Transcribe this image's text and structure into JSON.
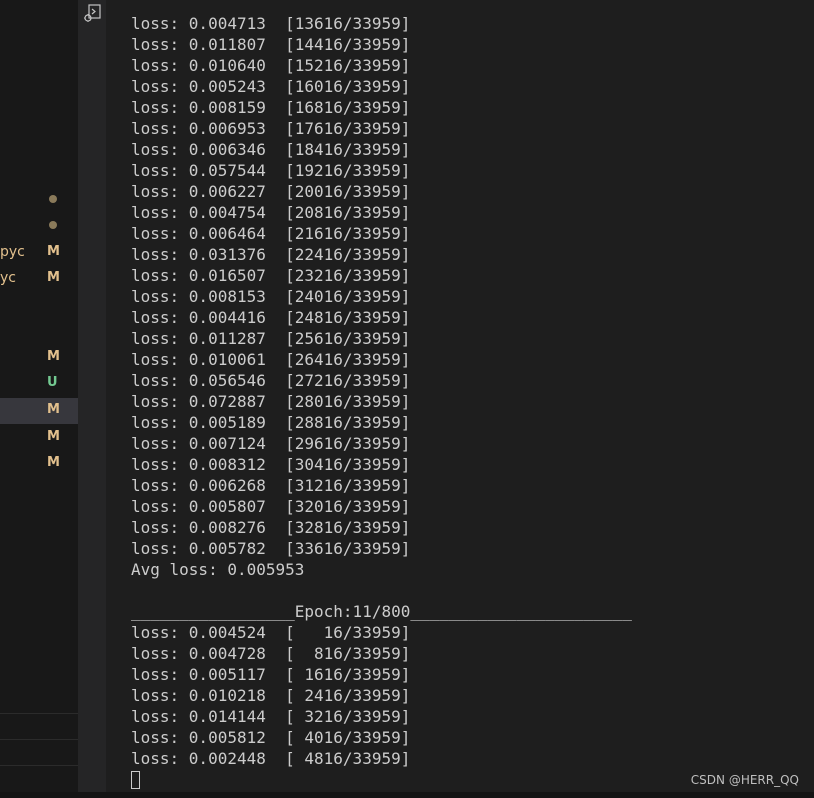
{
  "sidebar": {
    "files": [
      {
        "name": "",
        "badge": ""
      },
      {
        "name": "",
        "badge": ""
      },
      {
        "name": "pyc",
        "badge": "M"
      },
      {
        "name": "yc",
        "badge": "M"
      },
      {
        "name": "",
        "badge": "M"
      },
      {
        "name": "",
        "badge": "U"
      },
      {
        "name": "",
        "badge": "M"
      },
      {
        "name": "",
        "badge": "M"
      },
      {
        "name": "",
        "badge": "M"
      }
    ]
  },
  "terminal": {
    "lines": [
      "loss: 0.004713  [13616/33959]",
      "loss: 0.011807  [14416/33959]",
      "loss: 0.010640  [15216/33959]",
      "loss: 0.005243  [16016/33959]",
      "loss: 0.008159  [16816/33959]",
      "loss: 0.006953  [17616/33959]",
      "loss: 0.006346  [18416/33959]",
      "loss: 0.057544  [19216/33959]",
      "loss: 0.006227  [20016/33959]",
      "loss: 0.004754  [20816/33959]",
      "loss: 0.006464  [21616/33959]",
      "loss: 0.031376  [22416/33959]",
      "loss: 0.016507  [23216/33959]",
      "loss: 0.008153  [24016/33959]",
      "loss: 0.004416  [24816/33959]",
      "loss: 0.011287  [25616/33959]",
      "loss: 0.010061  [26416/33959]",
      "loss: 0.056546  [27216/33959]",
      "loss: 0.072887  [28016/33959]",
      "loss: 0.005189  [28816/33959]",
      "loss: 0.007124  [29616/33959]",
      "loss: 0.008312  [30416/33959]",
      "loss: 0.006268  [31216/33959]",
      "loss: 0.005807  [32016/33959]",
      "loss: 0.008276  [32816/33959]",
      "loss: 0.005782  [33616/33959]",
      "Avg loss: 0.005953",
      "",
      "_________________Epoch:11/800_______________________",
      "loss: 0.004524  [   16/33959]",
      "loss: 0.004728  [  816/33959]",
      "loss: 0.005117  [ 1616/33959]",
      "loss: 0.010218  [ 2416/33959]",
      "loss: 0.014144  [ 3216/33959]",
      "loss: 0.005812  [ 4016/33959]",
      "loss: 0.002448  [ 4816/33959]"
    ]
  },
  "watermark": "CSDN @HERR_QQ",
  "colors": {
    "background": "#1e1e1e",
    "text": "#cccccc",
    "modified": "#e2c08d",
    "untracked": "#73c991"
  },
  "icons": {
    "gutter": "debug-console-icon"
  }
}
